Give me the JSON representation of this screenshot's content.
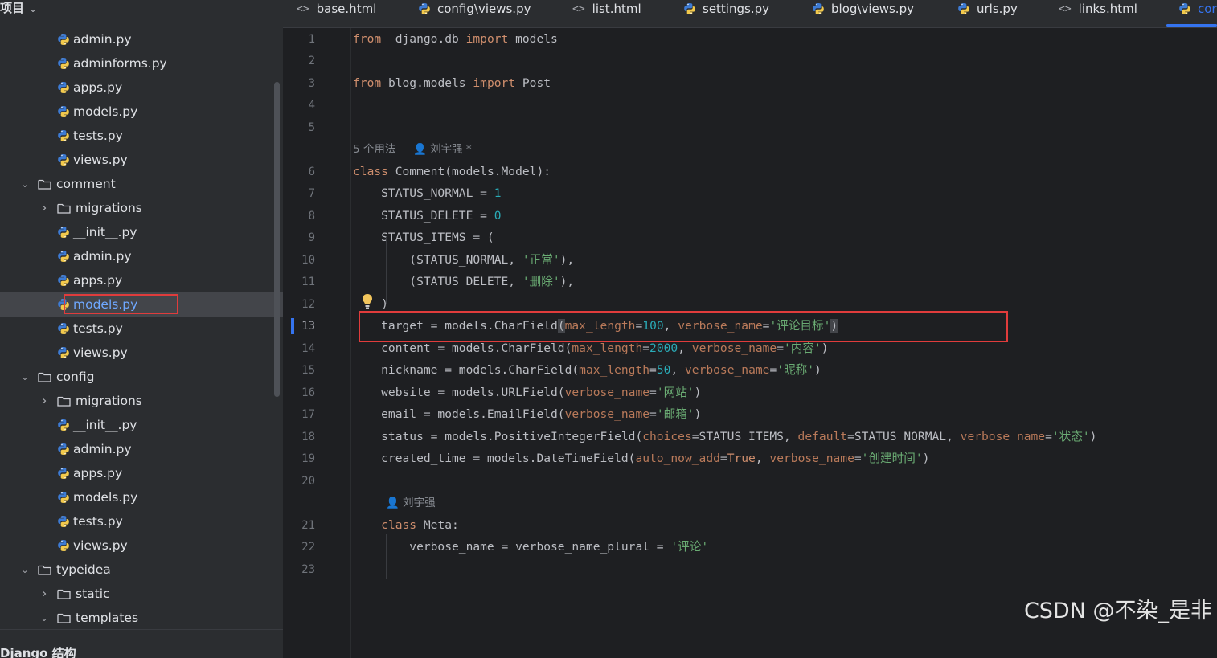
{
  "sidebar": {
    "title": "项目",
    "footer_title": "Django 结构",
    "items": [
      {
        "label": "admin.py",
        "type": "py",
        "depth": 2
      },
      {
        "label": "adminforms.py",
        "type": "py",
        "depth": 2
      },
      {
        "label": "apps.py",
        "type": "py",
        "depth": 2
      },
      {
        "label": "models.py",
        "type": "py",
        "depth": 2
      },
      {
        "label": "tests.py",
        "type": "py",
        "depth": 2
      },
      {
        "label": "views.py",
        "type": "py",
        "depth": 2
      },
      {
        "label": "comment",
        "type": "folder",
        "depth": 1,
        "expanded": true
      },
      {
        "label": "migrations",
        "type": "folder",
        "depth": 2,
        "expanded": false
      },
      {
        "label": "__init__.py",
        "type": "py",
        "depth": 2
      },
      {
        "label": "admin.py",
        "type": "py",
        "depth": 2
      },
      {
        "label": "apps.py",
        "type": "py",
        "depth": 2
      },
      {
        "label": "models.py",
        "type": "py",
        "depth": 2,
        "selected": true
      },
      {
        "label": "tests.py",
        "type": "py",
        "depth": 2
      },
      {
        "label": "views.py",
        "type": "py",
        "depth": 2
      },
      {
        "label": "config",
        "type": "folder",
        "depth": 1,
        "expanded": true
      },
      {
        "label": "migrations",
        "type": "folder",
        "depth": 2,
        "expanded": false
      },
      {
        "label": "__init__.py",
        "type": "py",
        "depth": 2
      },
      {
        "label": "admin.py",
        "type": "py",
        "depth": 2
      },
      {
        "label": "apps.py",
        "type": "py",
        "depth": 2
      },
      {
        "label": "models.py",
        "type": "py",
        "depth": 2
      },
      {
        "label": "tests.py",
        "type": "py",
        "depth": 2
      },
      {
        "label": "views.py",
        "type": "py",
        "depth": 2
      },
      {
        "label": "typeidea",
        "type": "folder",
        "depth": 1,
        "expanded": true
      },
      {
        "label": "static",
        "type": "folder",
        "depth": 2,
        "expanded": false
      },
      {
        "label": "templates",
        "type": "folder",
        "depth": 2,
        "expanded": true
      }
    ]
  },
  "tabs": [
    {
      "label": "base.html",
      "type": "html"
    },
    {
      "label": "config\\views.py",
      "type": "py"
    },
    {
      "label": "list.html",
      "type": "html"
    },
    {
      "label": "settings.py",
      "type": "py"
    },
    {
      "label": "blog\\views.py",
      "type": "py"
    },
    {
      "label": "urls.py",
      "type": "py"
    },
    {
      "label": "links.html",
      "type": "html"
    },
    {
      "label": "cor",
      "type": "py",
      "active": true
    }
  ],
  "editor": {
    "current_line": "13",
    "usage_hint": "5 个用法",
    "author_hint": "刘宇强 *",
    "author_hint2": "刘宇强",
    "lines": [
      {
        "n": "1",
        "tokens": [
          [
            "kw",
            "from"
          ],
          [
            "",
            "  django.db "
          ],
          [
            "kw",
            "import"
          ],
          [
            "",
            " models"
          ]
        ]
      },
      {
        "n": "2",
        "tokens": []
      },
      {
        "n": "3",
        "tokens": [
          [
            "kw",
            "from"
          ],
          [
            "",
            " blog.models "
          ],
          [
            "kw",
            "import"
          ],
          [
            "",
            " Post"
          ]
        ]
      },
      {
        "n": "4",
        "tokens": []
      },
      {
        "n": "5",
        "tokens": []
      },
      {
        "n": "6",
        "tokens": [
          [
            "kw",
            "class"
          ],
          [
            "",
            " Comment(models.Model):"
          ]
        ]
      },
      {
        "n": "7",
        "tokens": [
          [
            "",
            "    STATUS_NORMAL = "
          ],
          [
            "num",
            "1"
          ]
        ]
      },
      {
        "n": "8",
        "tokens": [
          [
            "",
            "    STATUS_DELETE = "
          ],
          [
            "num",
            "0"
          ]
        ]
      },
      {
        "n": "9",
        "tokens": [
          [
            "",
            "    STATUS_ITEMS = ("
          ]
        ]
      },
      {
        "n": "10",
        "tokens": [
          [
            "",
            "        (STATUS_NORMAL, "
          ],
          [
            "str",
            "'正常'"
          ],
          [
            "",
            "),"
          ]
        ]
      },
      {
        "n": "11",
        "tokens": [
          [
            "",
            "        (STATUS_DELETE, "
          ],
          [
            "str",
            "'删除'"
          ],
          [
            "",
            "),"
          ]
        ]
      },
      {
        "n": "12",
        "tokens": [
          [
            "",
            "    )"
          ]
        ]
      },
      {
        "n": "13",
        "tokens": [
          [
            "",
            "    target = models.CharField"
          ],
          [
            "bracket-hl",
            "("
          ],
          [
            "param2",
            "max_length"
          ],
          [
            "",
            "="
          ],
          [
            "num",
            "100"
          ],
          [
            "",
            ", "
          ],
          [
            "param2",
            "verbose_name"
          ],
          [
            "",
            "="
          ],
          [
            "str",
            "'评论目标'"
          ],
          [
            "bracket-hl",
            ")"
          ]
        ]
      },
      {
        "n": "14",
        "tokens": [
          [
            "",
            "    content = models.CharField("
          ],
          [
            "param2",
            "max_length"
          ],
          [
            "",
            "="
          ],
          [
            "num",
            "2000"
          ],
          [
            "",
            ", "
          ],
          [
            "param2",
            "verbose_name"
          ],
          [
            "",
            "="
          ],
          [
            "str",
            "'内容'"
          ],
          [
            "",
            ")"
          ]
        ]
      },
      {
        "n": "15",
        "tokens": [
          [
            "",
            "    nickname = models.CharField("
          ],
          [
            "param2",
            "max_length"
          ],
          [
            "",
            "="
          ],
          [
            "num",
            "50"
          ],
          [
            "",
            ", "
          ],
          [
            "param2",
            "verbose_name"
          ],
          [
            "",
            "="
          ],
          [
            "str",
            "'昵称'"
          ],
          [
            "",
            ")"
          ]
        ]
      },
      {
        "n": "16",
        "tokens": [
          [
            "",
            "    website = models.URLField("
          ],
          [
            "param2",
            "verbose_name"
          ],
          [
            "",
            "="
          ],
          [
            "str",
            "'网站'"
          ],
          [
            "",
            ")"
          ]
        ]
      },
      {
        "n": "17",
        "tokens": [
          [
            "",
            "    email = models.EmailField("
          ],
          [
            "param2",
            "verbose_name"
          ],
          [
            "",
            "="
          ],
          [
            "str",
            "'邮箱'"
          ],
          [
            "",
            ")"
          ]
        ]
      },
      {
        "n": "18",
        "tokens": [
          [
            "",
            "    status = models.PositiveIntegerField("
          ],
          [
            "param2",
            "choices"
          ],
          [
            "",
            "=STATUS_ITEMS, "
          ],
          [
            "param2",
            "default"
          ],
          [
            "",
            "=STATUS_NORMAL, "
          ],
          [
            "param2",
            "verbose_name"
          ],
          [
            "",
            "="
          ],
          [
            "str",
            "'状态'"
          ],
          [
            "",
            ")"
          ]
        ]
      },
      {
        "n": "19",
        "tokens": [
          [
            "",
            "    created_time = models.DateTimeField("
          ],
          [
            "param2",
            "auto_now_add"
          ],
          [
            "",
            "="
          ],
          [
            "kw",
            "True"
          ],
          [
            "",
            ", "
          ],
          [
            "param2",
            "verbose_name"
          ],
          [
            "",
            "="
          ],
          [
            "str",
            "'创建时间'"
          ],
          [
            "",
            ")"
          ]
        ]
      },
      {
        "n": "20",
        "tokens": []
      },
      {
        "n": "21",
        "tokens": [
          [
            "",
            "    "
          ],
          [
            "kw",
            "class"
          ],
          [
            "",
            " Meta:"
          ]
        ]
      },
      {
        "n": "22",
        "tokens": [
          [
            "",
            "        verbose_name = verbose_name_plural = "
          ],
          [
            "str",
            "'评论'"
          ]
        ]
      },
      {
        "n": "23",
        "tokens": []
      }
    ]
  },
  "watermark": "CSDN @不染_是非",
  "colors": {
    "selection_box": "#e03c3c",
    "accent": "#3574f0",
    "keyword": "#cf8e6d",
    "string": "#6aab73",
    "number": "#2aacb8"
  }
}
